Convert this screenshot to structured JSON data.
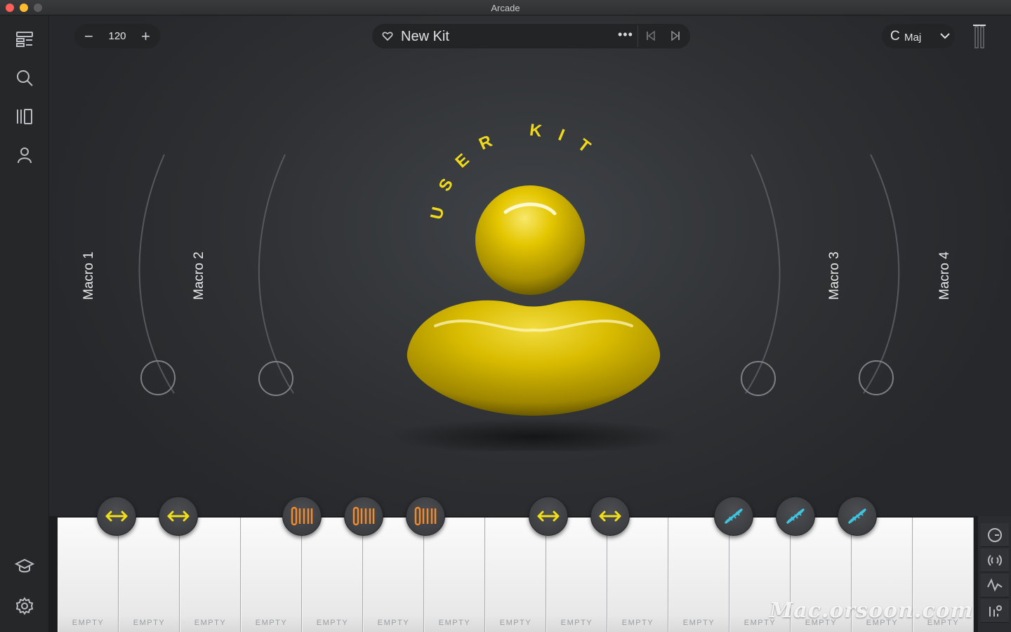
{
  "window": {
    "title": "Arcade"
  },
  "sidebar": {
    "items": [
      {
        "icon": "layout-icon"
      },
      {
        "icon": "search-icon"
      },
      {
        "icon": "library-icon"
      },
      {
        "icon": "user-icon"
      }
    ],
    "bottom": [
      {
        "icon": "graduation-cap-icon"
      },
      {
        "icon": "gear-icon"
      }
    ]
  },
  "header": {
    "tempo": {
      "minus": "−",
      "value": "120",
      "plus": "+"
    },
    "kit": {
      "name": "New Kit",
      "more": "•••"
    },
    "key": {
      "root": "C",
      "mode": "Maj"
    }
  },
  "macros": [
    "Macro 1",
    "Macro 2",
    "Macro 3",
    "Macro 4"
  ],
  "kit_title": "USER KIT",
  "keys": [
    "EMPTY",
    "EMPTY",
    "EMPTY",
    "EMPTY",
    "EMPTY",
    "EMPTY",
    "EMPTY",
    "EMPTY",
    "EMPTY",
    "EMPTY",
    "EMPTY",
    "EMPTY",
    "EMPTY",
    "EMPTY",
    "EMPTY"
  ],
  "pads": [
    {
      "type": "stretch",
      "color": "#f2df1a"
    },
    {
      "type": "stretch",
      "color": "#f2df1a"
    },
    {
      "type": "slice",
      "color": "#f28a2e"
    },
    {
      "type": "slice",
      "color": "#f28a2e"
    },
    {
      "type": "slice",
      "color": "#f28a2e"
    },
    {
      "type": "stretch",
      "color": "#f2df1a"
    },
    {
      "type": "stretch",
      "color": "#f2df1a"
    },
    {
      "type": "dna",
      "color": "#3fc4e0"
    },
    {
      "type": "dna",
      "color": "#3fc4e0"
    },
    {
      "type": "dna",
      "color": "#3fc4e0"
    }
  ],
  "side_tools": [
    "timer-icon",
    "broadcast-icon",
    "waveform-icon",
    "mixer-settings-icon"
  ],
  "watermark": "Mac.orsoon.com"
}
